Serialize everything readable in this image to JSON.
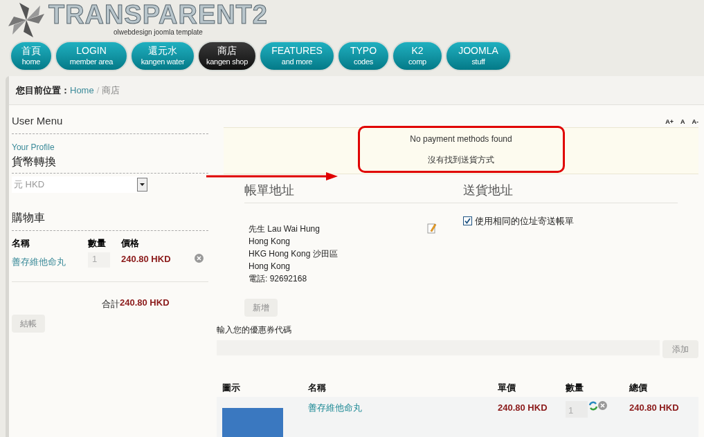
{
  "logo": {
    "title": "TRANSPARENT2",
    "tagline": "olwebdesign joomla template"
  },
  "nav": [
    {
      "label": "首頁",
      "sub": "home",
      "selected": false
    },
    {
      "label": "LOGIN",
      "sub": "member area",
      "selected": false
    },
    {
      "label": "還元水",
      "sub": "kangen water",
      "selected": false
    },
    {
      "label": "商店",
      "sub": "kangen shop",
      "selected": true
    },
    {
      "label": "FEATURES",
      "sub": "and more",
      "selected": false
    },
    {
      "label": "TYPO",
      "sub": "codes",
      "selected": false
    },
    {
      "label": "K2",
      "sub": "comp",
      "selected": false
    },
    {
      "label": "JOOMLA",
      "sub": "stuff",
      "selected": false
    }
  ],
  "breadcrumb": {
    "prefix": "您目前位置：",
    "items": [
      "Home",
      "商店"
    ],
    "separator": "/"
  },
  "sidebar": {
    "user_menu": {
      "title": "User Menu",
      "items": [
        "Your Profile"
      ]
    },
    "currency": {
      "title": "貨幣轉換",
      "value": "元 HKD"
    },
    "cart": {
      "title": "購物車",
      "columns": [
        "名稱",
        "數量",
        "價格"
      ],
      "rows": [
        {
          "name": "善存維他命丸",
          "quantity": "1",
          "price": "240.80 HKD"
        }
      ],
      "total_label": "合計",
      "total": "240.80 HKD",
      "checkout": "結帳"
    }
  },
  "font_size_controls": [
    "A+",
    "A",
    "A-"
  ],
  "messages": [
    "No payment methods found",
    "沒有找到送貨方式"
  ],
  "billing": {
    "title": "帳單地址",
    "lines": [
      "先生 Lau Wai Hung",
      "Hong Kong",
      "HKG Hong Kong 沙田區",
      "Hong Kong",
      "電話: 92692168"
    ],
    "add_button": "新增"
  },
  "shipping": {
    "title": "送貨地址",
    "same_as_billing": {
      "label": "使用相同的位址寄送帳單",
      "checked": true
    }
  },
  "coupon": {
    "label": "輸入您的優惠券代碼",
    "button": "添加"
  },
  "order": {
    "columns": [
      "圖示",
      "名稱",
      "單價",
      "數量",
      "總價"
    ],
    "rows": [
      {
        "name": "善存維他命丸",
        "unit_price": "240.80 HKD",
        "quantity": "1",
        "total": "240.80 HKD"
      }
    ]
  }
}
